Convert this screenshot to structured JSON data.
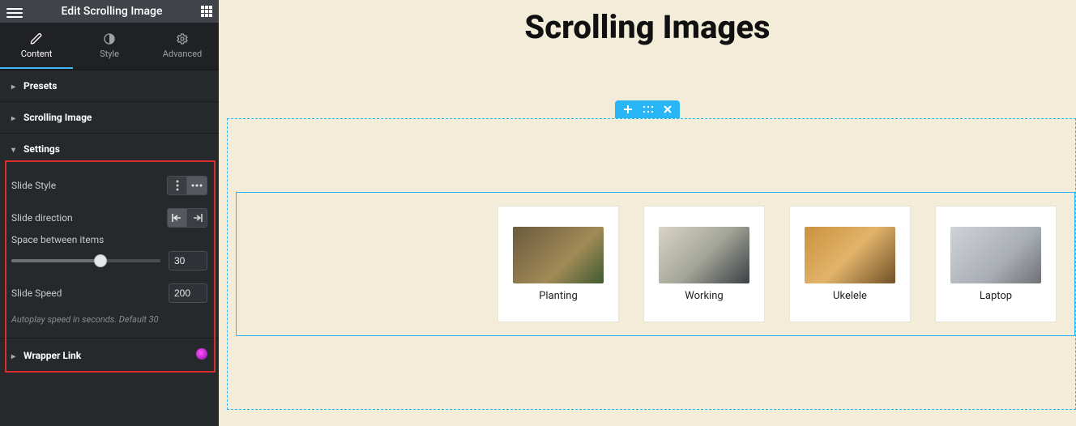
{
  "header": {
    "title": "Edit Scrolling Image"
  },
  "tabs": {
    "content": "Content",
    "style": "Style",
    "advanced": "Advanced"
  },
  "sections": {
    "presets": "Presets",
    "scrolling_image": "Scrolling Image",
    "settings": "Settings",
    "wrapper_link": "Wrapper Link"
  },
  "settings": {
    "slide_style_label": "Slide Style",
    "slide_direction_label": "Slide direction",
    "space_between_label": "Space between items",
    "space_between_value": "30",
    "slide_speed_label": "Slide Speed",
    "slide_speed_value": "200",
    "hint": "Autoplay speed in seconds. Default 30"
  },
  "canvas": {
    "page_title": "Scrolling Images",
    "cards": [
      {
        "label": "Planting",
        "thumb_class": "planting"
      },
      {
        "label": "Working",
        "thumb_class": "working"
      },
      {
        "label": "Ukelele",
        "thumb_class": "ukelele"
      },
      {
        "label": "Laptop",
        "thumb_class": "laptop"
      }
    ]
  }
}
